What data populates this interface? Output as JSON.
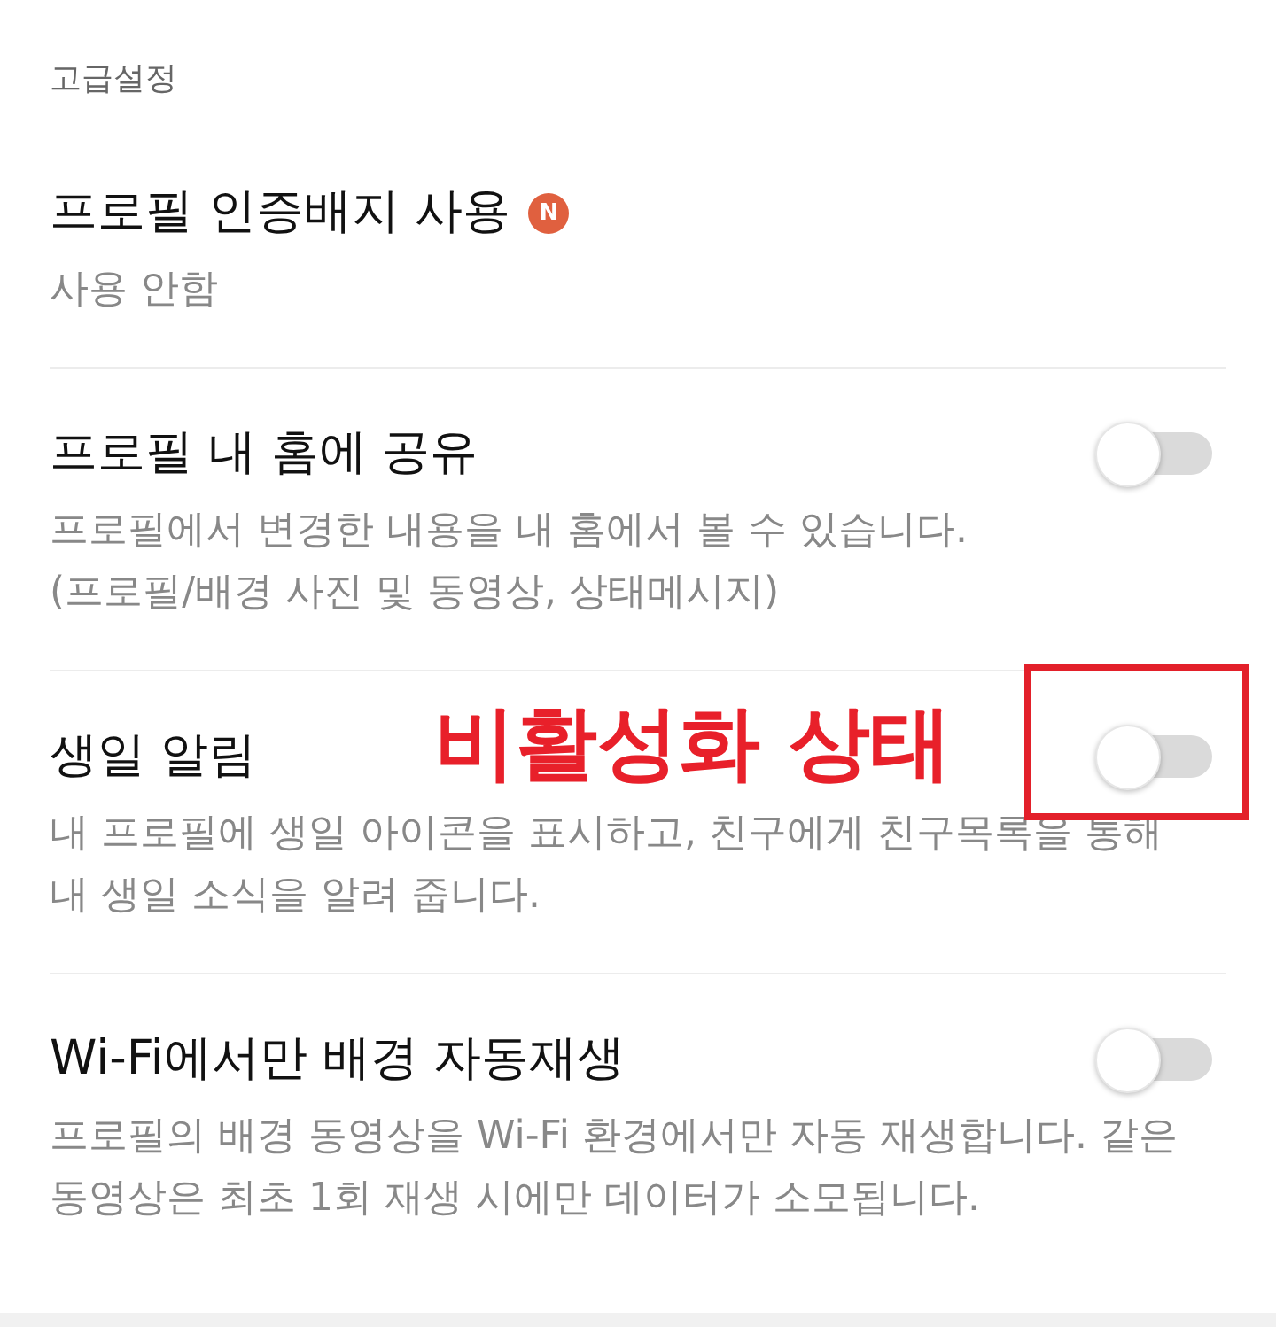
{
  "section_title": "고급설정",
  "items": [
    {
      "kind": "value",
      "title": "프로필 인증배지 사용",
      "badge": "N",
      "value": "사용 안함"
    },
    {
      "kind": "toggle",
      "title": "프로필 내 홈에 공유",
      "description": "프로필에서 변경한 내용을 내 홈에서 볼 수 있습니다.\n(프로필/배경 사진 및 동영상, 상태메시지)",
      "on": false,
      "highlighted": false
    },
    {
      "kind": "toggle",
      "title": "생일 알림",
      "annotation": "비활성화 상태",
      "description": "내 프로필에 생일 아이콘을 표시하고, 친구에게 친구목록을 통해\n내 생일 소식을 알려 줍니다.",
      "on": false,
      "highlighted": true
    },
    {
      "kind": "toggle",
      "title": "Wi-Fi에서만 배경 자동재생",
      "description": "프로필의 배경 동영상을 Wi-Fi 환경에서만 자동 재생합니다. 같은\n동영상은 최초 1회 재생 시에만 데이터가 소모됩니다.",
      "on": false,
      "highlighted": false
    }
  ]
}
